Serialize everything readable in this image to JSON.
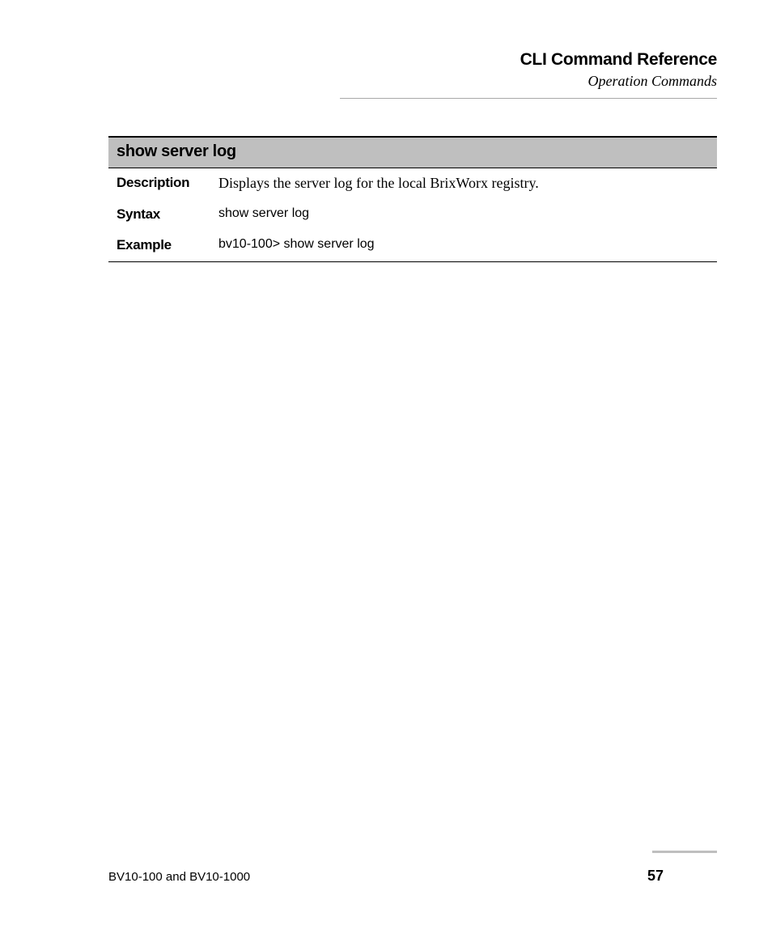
{
  "header": {
    "title": "CLI Command Reference",
    "subtitle": "Operation Commands"
  },
  "command": {
    "name": "show server log",
    "rows": [
      {
        "label": "Description",
        "value": "Displays the server log for the local BrixWorx registry.",
        "style": "serif"
      },
      {
        "label": "Syntax",
        "value": "show server log",
        "style": "sans"
      },
      {
        "label": "Example",
        "value": "bv10-100> show server log",
        "style": "sans"
      }
    ]
  },
  "footer": {
    "left": "BV10-100 and BV10-1000",
    "page": "57"
  }
}
